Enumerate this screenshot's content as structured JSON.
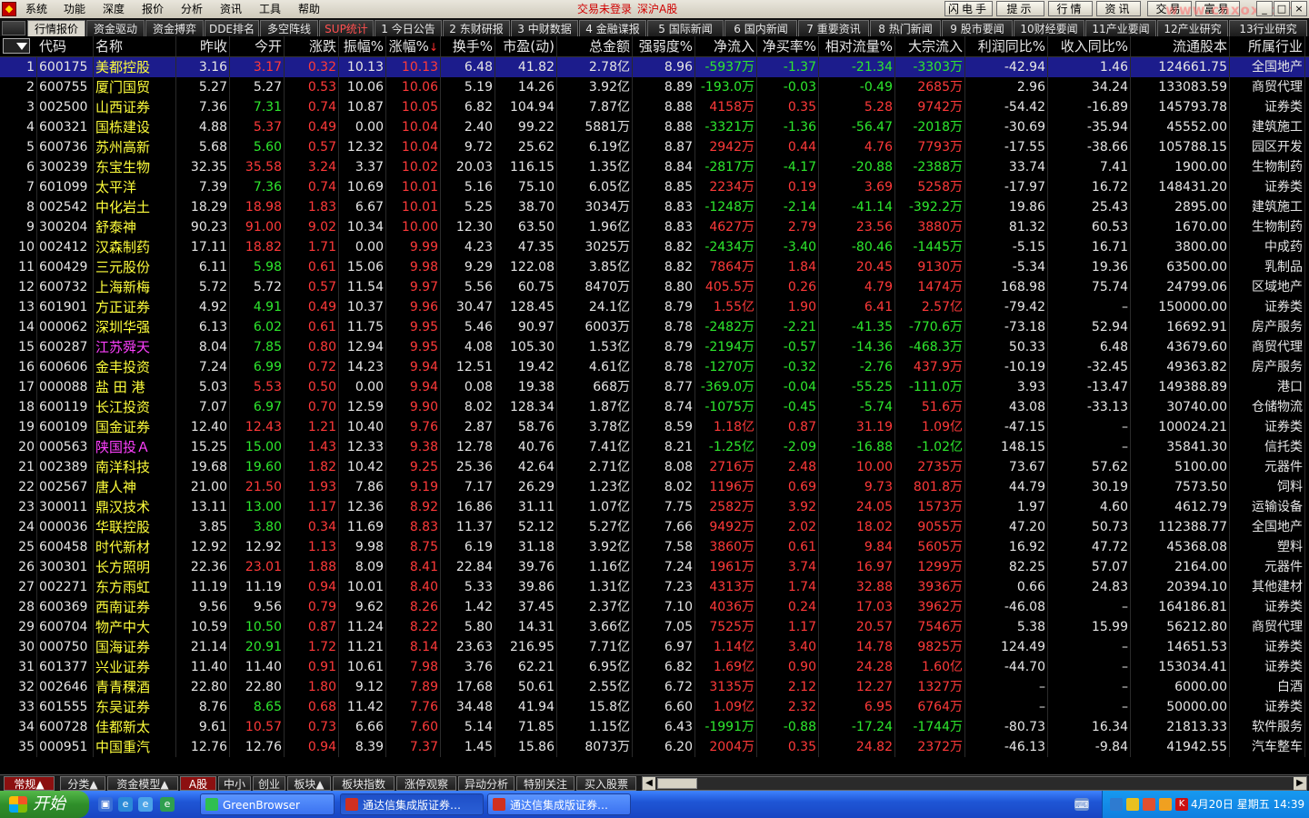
{
  "menu": [
    "系统",
    "功能",
    "深度",
    "报价",
    "分析",
    "资讯",
    "工具",
    "帮助"
  ],
  "status": {
    "login": "交易未登录",
    "market": "深沪A股"
  },
  "top_buttons": [
    "闪电手",
    "提示",
    "行情",
    "资讯",
    "交易",
    "富易"
  ],
  "watermark": "www.cnxox.com",
  "tabs": [
    "行情报价",
    "资金驱动",
    "资金搏弈",
    "DDE排名",
    "多空阵线",
    "SUP统计",
    "1 今日公告",
    "2 东财研报",
    "3 中财数据",
    "4 金融谍报",
    "5 国际新闻",
    "6 国内新闻",
    "7 重要资讯",
    "8 热门新闻",
    "9 股市要闻",
    "10财经要闻",
    "11产业要闻",
    "12产业研究",
    "13行业研究"
  ],
  "columns": [
    "",
    "代码",
    "名称",
    "昨收",
    "今开",
    "涨跌",
    "振幅%",
    "涨幅%",
    "换手%",
    "市盈(动)",
    "总金额",
    "强弱度%",
    "净流入",
    "净买率%",
    "相对流量%",
    "大宗流入",
    "利润同比%",
    "收入同比%",
    "流通股本",
    "所属行业"
  ],
  "sort_marker": "↓",
  "rows": [
    [
      "1",
      "600175",
      "美都控股",
      "3.16",
      "3.17",
      "0.32",
      "10.13",
      "10.13",
      "6.48",
      "41.82",
      "2.78亿",
      "8.96",
      "-5937万",
      "-1.37",
      "-21.34",
      "-3303万",
      "-42.94",
      "1.46",
      "124661.75",
      "全国地产"
    ],
    [
      "2",
      "600755",
      "厦门国贸",
      "5.27",
      "5.27",
      "0.53",
      "10.06",
      "10.06",
      "5.19",
      "14.26",
      "3.92亿",
      "8.89",
      "-193.0万",
      "-0.03",
      "-0.49",
      "2685万",
      "2.96",
      "34.24",
      "133083.59",
      "商贸代理"
    ],
    [
      "3",
      "002500",
      "山西证券",
      "7.36",
      "7.31",
      "0.74",
      "10.87",
      "10.05",
      "6.82",
      "104.94",
      "7.87亿",
      "8.88",
      "4158万",
      "0.35",
      "5.28",
      "9742万",
      "-54.42",
      "-16.89",
      "145793.78",
      "证券类"
    ],
    [
      "4",
      "600321",
      "国栋建设",
      "4.88",
      "5.37",
      "0.49",
      "0.00",
      "10.04",
      "2.40",
      "99.22",
      "5881万",
      "8.88",
      "-3321万",
      "-1.36",
      "-56.47",
      "-2018万",
      "-30.69",
      "-35.94",
      "45552.00",
      "建筑施工"
    ],
    [
      "5",
      "600736",
      "苏州高新",
      "5.68",
      "5.60",
      "0.57",
      "12.32",
      "10.04",
      "9.72",
      "25.62",
      "6.19亿",
      "8.87",
      "2942万",
      "0.44",
      "4.76",
      "7793万",
      "-17.55",
      "-38.66",
      "105788.15",
      "园区开发"
    ],
    [
      "6",
      "300239",
      "东宝生物",
      "32.35",
      "35.58",
      "3.24",
      "3.37",
      "10.02",
      "20.03",
      "116.15",
      "1.35亿",
      "8.84",
      "-2817万",
      "-4.17",
      "-20.88",
      "-2388万",
      "33.74",
      "7.41",
      "1900.00",
      "生物制药"
    ],
    [
      "7",
      "601099",
      "太平洋",
      "7.39",
      "7.36",
      "0.74",
      "10.69",
      "10.01",
      "5.16",
      "75.10",
      "6.05亿",
      "8.85",
      "2234万",
      "0.19",
      "3.69",
      "5258万",
      "-17.97",
      "16.72",
      "148431.20",
      "证券类"
    ],
    [
      "8",
      "002542",
      "中化岩土",
      "18.29",
      "18.98",
      "1.83",
      "6.67",
      "10.01",
      "5.25",
      "38.70",
      "3034万",
      "8.83",
      "-1248万",
      "-2.14",
      "-41.14",
      "-392.2万",
      "19.86",
      "25.43",
      "2895.00",
      "建筑施工"
    ],
    [
      "9",
      "300204",
      "舒泰神",
      "90.23",
      "91.00",
      "9.02",
      "10.34",
      "10.00",
      "12.30",
      "63.50",
      "1.96亿",
      "8.83",
      "4627万",
      "2.79",
      "23.56",
      "3880万",
      "81.32",
      "60.53",
      "1670.00",
      "生物制药"
    ],
    [
      "10",
      "002412",
      "汉森制药",
      "17.11",
      "18.82",
      "1.71",
      "0.00",
      "9.99",
      "4.23",
      "47.35",
      "3025万",
      "8.82",
      "-2434万",
      "-3.40",
      "-80.46",
      "-1445万",
      "-5.15",
      "16.71",
      "3800.00",
      "中成药"
    ],
    [
      "11",
      "600429",
      "三元股份",
      "6.11",
      "5.98",
      "0.61",
      "15.06",
      "9.98",
      "9.29",
      "122.08",
      "3.85亿",
      "8.82",
      "7864万",
      "1.84",
      "20.45",
      "9130万",
      "-5.34",
      "19.36",
      "63500.00",
      "乳制品"
    ],
    [
      "12",
      "600732",
      "上海新梅",
      "5.72",
      "5.72",
      "0.57",
      "11.54",
      "9.97",
      "5.56",
      "60.75",
      "8470万",
      "8.80",
      "405.5万",
      "0.26",
      "4.79",
      "1474万",
      "168.98",
      "75.74",
      "24799.06",
      "区域地产"
    ],
    [
      "13",
      "601901",
      "方正证券",
      "4.92",
      "4.91",
      "0.49",
      "10.37",
      "9.96",
      "30.47",
      "128.45",
      "24.1亿",
      "8.79",
      "1.55亿",
      "1.90",
      "6.41",
      "2.57亿",
      "-79.42",
      "–",
      "150000.00",
      "证券类"
    ],
    [
      "14",
      "000062",
      "深圳华强",
      "6.13",
      "6.02",
      "0.61",
      "11.75",
      "9.95",
      "5.46",
      "90.97",
      "6003万",
      "8.78",
      "-2482万",
      "-2.21",
      "-41.35",
      "-770.6万",
      "-73.18",
      "52.94",
      "16692.91",
      "房产服务"
    ],
    [
      "15",
      "600287",
      "江苏舜天",
      "8.04",
      "7.85",
      "0.80",
      "12.94",
      "9.95",
      "4.08",
      "105.30",
      "1.53亿",
      "8.79",
      "-2194万",
      "-0.57",
      "-14.36",
      "-468.3万",
      "50.33",
      "6.48",
      "43679.60",
      "商贸代理"
    ],
    [
      "16",
      "600606",
      "金丰投资",
      "7.24",
      "6.99",
      "0.72",
      "14.23",
      "9.94",
      "12.51",
      "19.42",
      "4.61亿",
      "8.78",
      "-1270万",
      "-0.32",
      "-2.76",
      "437.9万",
      "-10.19",
      "-32.45",
      "49363.82",
      "房产服务"
    ],
    [
      "17",
      "000088",
      "盐 田 港",
      "5.03",
      "5.53",
      "0.50",
      "0.00",
      "9.94",
      "0.08",
      "19.38",
      "668万",
      "8.77",
      "-369.0万",
      "-0.04",
      "-55.25",
      "-111.0万",
      "3.93",
      "-13.47",
      "149388.89",
      "港口"
    ],
    [
      "18",
      "600119",
      "长江投资",
      "7.07",
      "6.97",
      "0.70",
      "12.59",
      "9.90",
      "8.02",
      "128.34",
      "1.87亿",
      "8.74",
      "-1075万",
      "-0.45",
      "-5.74",
      "51.6万",
      "43.08",
      "-33.13",
      "30740.00",
      "仓储物流"
    ],
    [
      "19",
      "600109",
      "国金证券",
      "12.40",
      "12.43",
      "1.21",
      "10.40",
      "9.76",
      "2.87",
      "58.76",
      "3.78亿",
      "8.59",
      "1.18亿",
      "0.87",
      "31.19",
      "1.09亿",
      "-47.15",
      "–",
      "100024.21",
      "证券类"
    ],
    [
      "20",
      "000563",
      "陕国投Ａ",
      "15.25",
      "15.00",
      "1.43",
      "12.33",
      "9.38",
      "12.78",
      "40.76",
      "7.41亿",
      "8.21",
      "-1.25亿",
      "-2.09",
      "-16.88",
      "-1.02亿",
      "148.15",
      "–",
      "35841.30",
      "信托类"
    ],
    [
      "21",
      "002389",
      "南洋科技",
      "19.68",
      "19.60",
      "1.82",
      "10.42",
      "9.25",
      "25.36",
      "42.64",
      "2.71亿",
      "8.08",
      "2716万",
      "2.48",
      "10.00",
      "2735万",
      "73.67",
      "57.62",
      "5100.00",
      "元器件"
    ],
    [
      "22",
      "002567",
      "唐人神",
      "21.00",
      "21.50",
      "1.93",
      "7.86",
      "9.19",
      "7.17",
      "26.29",
      "1.23亿",
      "8.02",
      "1196万",
      "0.69",
      "9.73",
      "801.8万",
      "44.79",
      "30.19",
      "7573.50",
      "饲料"
    ],
    [
      "23",
      "300011",
      "鼎汉技术",
      "13.11",
      "13.00",
      "1.17",
      "12.36",
      "8.92",
      "16.86",
      "31.11",
      "1.07亿",
      "7.75",
      "2582万",
      "3.92",
      "24.05",
      "1573万",
      "1.97",
      "4.60",
      "4612.79",
      "运输设备"
    ],
    [
      "24",
      "000036",
      "华联控股",
      "3.85",
      "3.80",
      "0.34",
      "11.69",
      "8.83",
      "11.37",
      "52.12",
      "5.27亿",
      "7.66",
      "9492万",
      "2.02",
      "18.02",
      "9055万",
      "47.20",
      "50.73",
      "112388.77",
      "全国地产"
    ],
    [
      "25",
      "600458",
      "时代新材",
      "12.92",
      "12.92",
      "1.13",
      "9.98",
      "8.75",
      "6.19",
      "31.18",
      "3.92亿",
      "7.58",
      "3860万",
      "0.61",
      "9.84",
      "5605万",
      "16.92",
      "47.72",
      "45368.08",
      "塑料"
    ],
    [
      "26",
      "300301",
      "长方照明",
      "22.36",
      "23.01",
      "1.88",
      "8.09",
      "8.41",
      "22.84",
      "39.76",
      "1.16亿",
      "7.24",
      "1961万",
      "3.74",
      "16.97",
      "1299万",
      "82.25",
      "57.07",
      "2164.00",
      "元器件"
    ],
    [
      "27",
      "002271",
      "东方雨虹",
      "11.19",
      "11.19",
      "0.94",
      "10.01",
      "8.40",
      "5.33",
      "39.86",
      "1.31亿",
      "7.23",
      "4313万",
      "1.74",
      "32.88",
      "3936万",
      "0.66",
      "24.83",
      "20394.10",
      "其他建材"
    ],
    [
      "28",
      "600369",
      "西南证券",
      "9.56",
      "9.56",
      "0.79",
      "9.62",
      "8.26",
      "1.42",
      "37.45",
      "2.37亿",
      "7.10",
      "4036万",
      "0.24",
      "17.03",
      "3962万",
      "-46.08",
      "–",
      "164186.81",
      "证券类"
    ],
    [
      "29",
      "600704",
      "物产中大",
      "10.59",
      "10.50",
      "0.87",
      "11.24",
      "8.22",
      "5.80",
      "14.31",
      "3.66亿",
      "7.05",
      "7525万",
      "1.17",
      "20.57",
      "7546万",
      "5.38",
      "15.99",
      "56212.80",
      "商贸代理"
    ],
    [
      "30",
      "000750",
      "国海证券",
      "21.14",
      "20.91",
      "1.72",
      "11.21",
      "8.14",
      "23.63",
      "216.95",
      "7.71亿",
      "6.97",
      "1.14亿",
      "3.40",
      "14.78",
      "9825万",
      "124.49",
      "–",
      "14651.53",
      "证券类"
    ],
    [
      "31",
      "601377",
      "兴业证券",
      "11.40",
      "11.40",
      "0.91",
      "10.61",
      "7.98",
      "3.76",
      "62.21",
      "6.95亿",
      "6.82",
      "1.69亿",
      "0.90",
      "24.28",
      "1.60亿",
      "-44.70",
      "–",
      "153034.41",
      "证券类"
    ],
    [
      "32",
      "002646",
      "青青稞酒",
      "22.80",
      "22.80",
      "1.80",
      "9.12",
      "7.89",
      "17.68",
      "50.61",
      "2.55亿",
      "6.72",
      "3135万",
      "2.12",
      "12.27",
      "1327万",
      "–",
      "–",
      "6000.00",
      "白酒"
    ],
    [
      "33",
      "601555",
      "东吴证券",
      "8.76",
      "8.65",
      "0.68",
      "11.42",
      "7.76",
      "34.48",
      "41.94",
      "15.8亿",
      "6.60",
      "1.09亿",
      "2.32",
      "6.95",
      "6764万",
      "–",
      "–",
      "50000.00",
      "证券类"
    ],
    [
      "34",
      "600728",
      "佳都新太",
      "9.61",
      "10.57",
      "0.73",
      "6.66",
      "7.60",
      "5.14",
      "71.85",
      "1.15亿",
      "6.43",
      "-1991万",
      "-0.88",
      "-17.24",
      "-1744万",
      "-80.73",
      "16.34",
      "21813.33",
      "软件服务"
    ],
    [
      "35",
      "000951",
      "中国重汽",
      "12.76",
      "12.76",
      "0.94",
      "8.39",
      "7.37",
      "1.45",
      "15.86",
      "8073万",
      "6.20",
      "2004万",
      "0.35",
      "24.82",
      "2372万",
      "-46.13",
      "-9.84",
      "41942.55",
      "汽车整车"
    ]
  ],
  "sheet_tabs": [
    "常规▲",
    "分类▲",
    "资金模型▲",
    "A股",
    "中小",
    "创业",
    "板块▲",
    "板块指数",
    "涨停观察",
    "异动分析",
    "特别关注",
    "买入股票"
  ],
  "taskbar": {
    "start": "开始",
    "windows": [
      "GreenBrowser",
      "通达信集成版证券…",
      "通达信集成版证券…"
    ],
    "clock": "4月20日 星期五 14:39"
  },
  "colors": {
    "up": "#ff3a3a",
    "down": "#2ee82e",
    "name": "#ffff3c",
    "selected_row": "#1c1c8c",
    "highlight_name": "#ff40ff"
  }
}
